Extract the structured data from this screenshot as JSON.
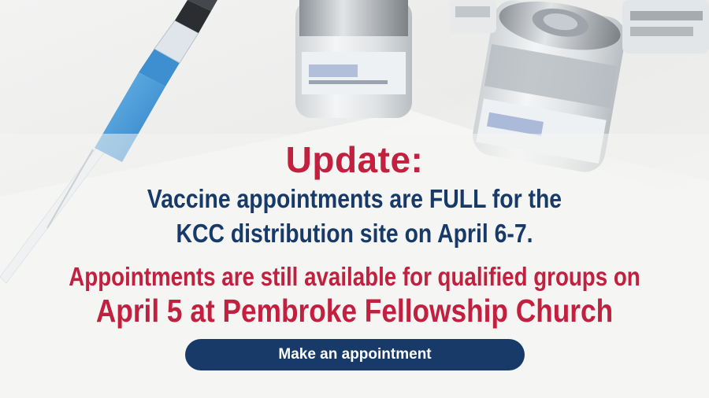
{
  "banner": {
    "headline": "Update:",
    "line1": "Vaccine appointments are FULL for the",
    "line2": "KCC distribution site on April 6-7.",
    "line3": "Appointments are still available for qualified groups on",
    "line4": "April 5 at Pembroke Fellowship Church",
    "cta_label": "Make an appointment"
  },
  "colors": {
    "accent_red": "#c2203f",
    "navy": "#173a68",
    "background": "#f0f0ef"
  },
  "icons": [
    "syringe-icon",
    "vaccine-vial-icon"
  ]
}
